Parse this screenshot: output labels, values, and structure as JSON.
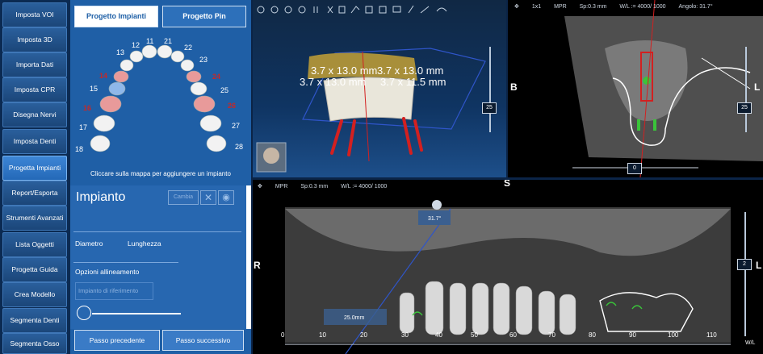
{
  "nav": {
    "items": [
      "Imposta VOI",
      "Imposta 3D",
      "Importa Dati",
      "Imposta CPR",
      "Disegna Nervi",
      "Imposta Denti",
      "Progetta Impianti",
      "Report/Esporta",
      "Strumenti Avanzati",
      "Lista Oggetti",
      "Progetta Guida",
      "Crea Modello",
      "Segmenta Denti",
      "Segmenta Osso"
    ],
    "active": "Progetta Impianti"
  },
  "panel": {
    "tab_impianti": "Progetto Impianti",
    "tab_pin": "Progetto Pin",
    "teeth_normal": [
      "11",
      "12",
      "13",
      "15",
      "17",
      "18",
      "21",
      "22",
      "23",
      "25",
      "27",
      "28"
    ],
    "teeth_selected": [
      "14",
      "16",
      "24",
      "26"
    ],
    "hint": "Cliccare sulla mappa per aggiungere un impianto",
    "impianto": {
      "title": "Impianto",
      "cambia": "Cambia",
      "diametro": "Diametro",
      "lunghezza": "Lunghezza",
      "opzioni": "Opzioni allineamento",
      "impianto_rif": "Impianto di riferimento"
    },
    "prev": "Passo precedente",
    "next": "Passo successivo"
  },
  "view3d": {
    "label1": "3.7 x 13.0 mm",
    "label2": "3.7 x 13.0 mm",
    "label3": "3.7 x 13.0 mm",
    "label4": "3.7 x 11.5 mm",
    "slider_value": "25"
  },
  "axial": {
    "layout": "1x1",
    "mode": "MPR",
    "sp": "Sp:0.3 mm",
    "wl": "W/L := 4000/ 1000",
    "angle": "Angolo: 31.7°",
    "left": "B",
    "right": "L",
    "slider_value": "25",
    "h_slider_value": "0"
  },
  "panoramic": {
    "mode": "MPR",
    "sp": "Sp:0.3 mm",
    "wl": "W/L := 4000/ 1000",
    "top": "S",
    "left": "R",
    "right": "L",
    "angle": "31.7°",
    "length": "25.0mm",
    "slider_value": "2",
    "ruler": [
      "0",
      "10",
      "20",
      "30",
      "40",
      "50",
      "60",
      "70",
      "80",
      "90",
      "100",
      "110"
    ],
    "wl_short": "W/L"
  },
  "colors": {
    "nav_bg": "#0b2a52",
    "panel": "#1f5fa6",
    "accent": "#3d86d6",
    "implant": "#c62828",
    "selected_tooth": "#e89a9a",
    "blue_tooth": "#8fb8ea"
  }
}
